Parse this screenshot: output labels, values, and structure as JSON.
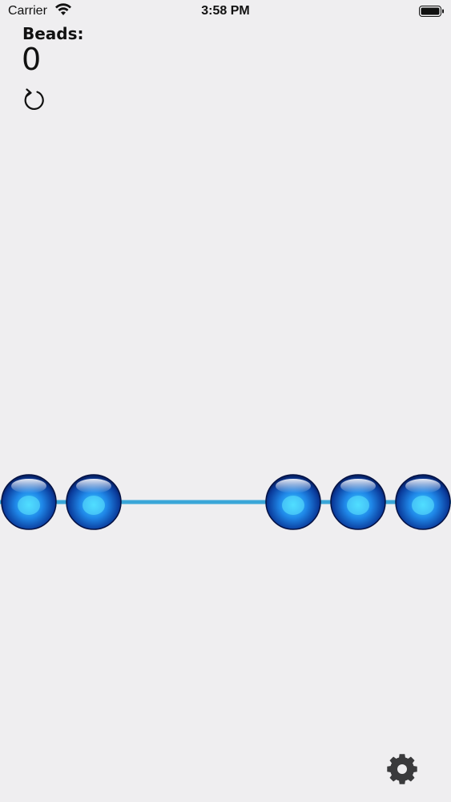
{
  "status_bar": {
    "carrier": "Carrier",
    "time": "3:58 PM",
    "wifi_icon": "wifi-icon",
    "battery_icon": "battery-icon"
  },
  "counter": {
    "label": "Beads:",
    "value": "0"
  },
  "controls": {
    "reset_icon": "reset-icon",
    "settings_icon": "gear-icon"
  },
  "string": {
    "bead_count": 5,
    "bead_color": "#1f87e8",
    "string_color": "#3aa6d8"
  }
}
